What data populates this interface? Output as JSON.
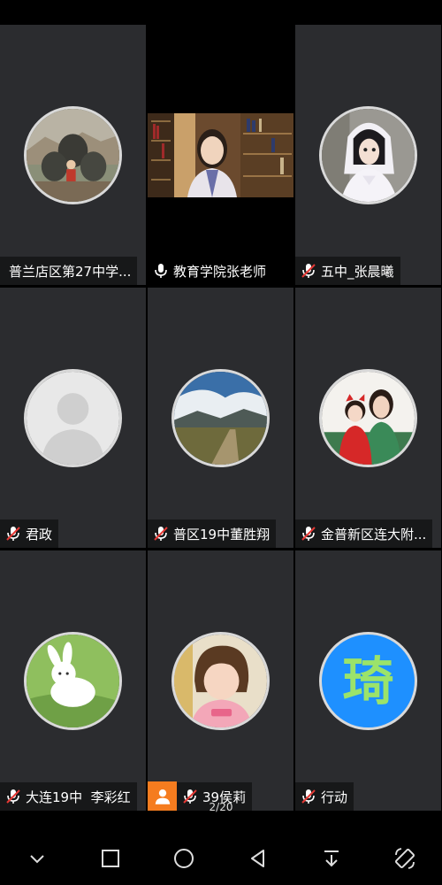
{
  "participants": [
    {
      "name": "普兰店区第27中学...",
      "mic": "none",
      "avatar": "statue-icon"
    },
    {
      "name": "教育学院张老师",
      "mic": "on",
      "avatar": "video-feed"
    },
    {
      "name": "五中_张晨曦",
      "mic": "muted",
      "avatar": "doll-icon"
    },
    {
      "name": "君政",
      "mic": "muted",
      "avatar": "default-person-icon"
    },
    {
      "name": "普区19中董胜翔",
      "mic": "muted",
      "avatar": "landscape-icon"
    },
    {
      "name": "金普新区连大附...",
      "mic": "muted",
      "avatar": "mother-daughter-icon"
    },
    {
      "name": "大连19中  李彩红",
      "mic": "muted",
      "avatar": "rabbit-icon"
    },
    {
      "name": "39侯莉",
      "mic": "muted",
      "avatar": "girl-icon"
    },
    {
      "name": "行动",
      "mic": "muted",
      "avatar": "qi-character-icon"
    }
  ],
  "avatar_logo_text": "琦",
  "pagination": {
    "indicator": "2/20"
  },
  "navbar": {
    "items": [
      "chevron-down-icon",
      "square-icon",
      "circle-icon",
      "triangle-back-icon",
      "download-arrow-icon",
      "rotate-icon"
    ]
  },
  "colors": {
    "tile_bg": "#2b2c2f",
    "badge_orange": "#f57c1f",
    "muted_red": "#e53935",
    "logo_blue": "#1e90ff"
  }
}
